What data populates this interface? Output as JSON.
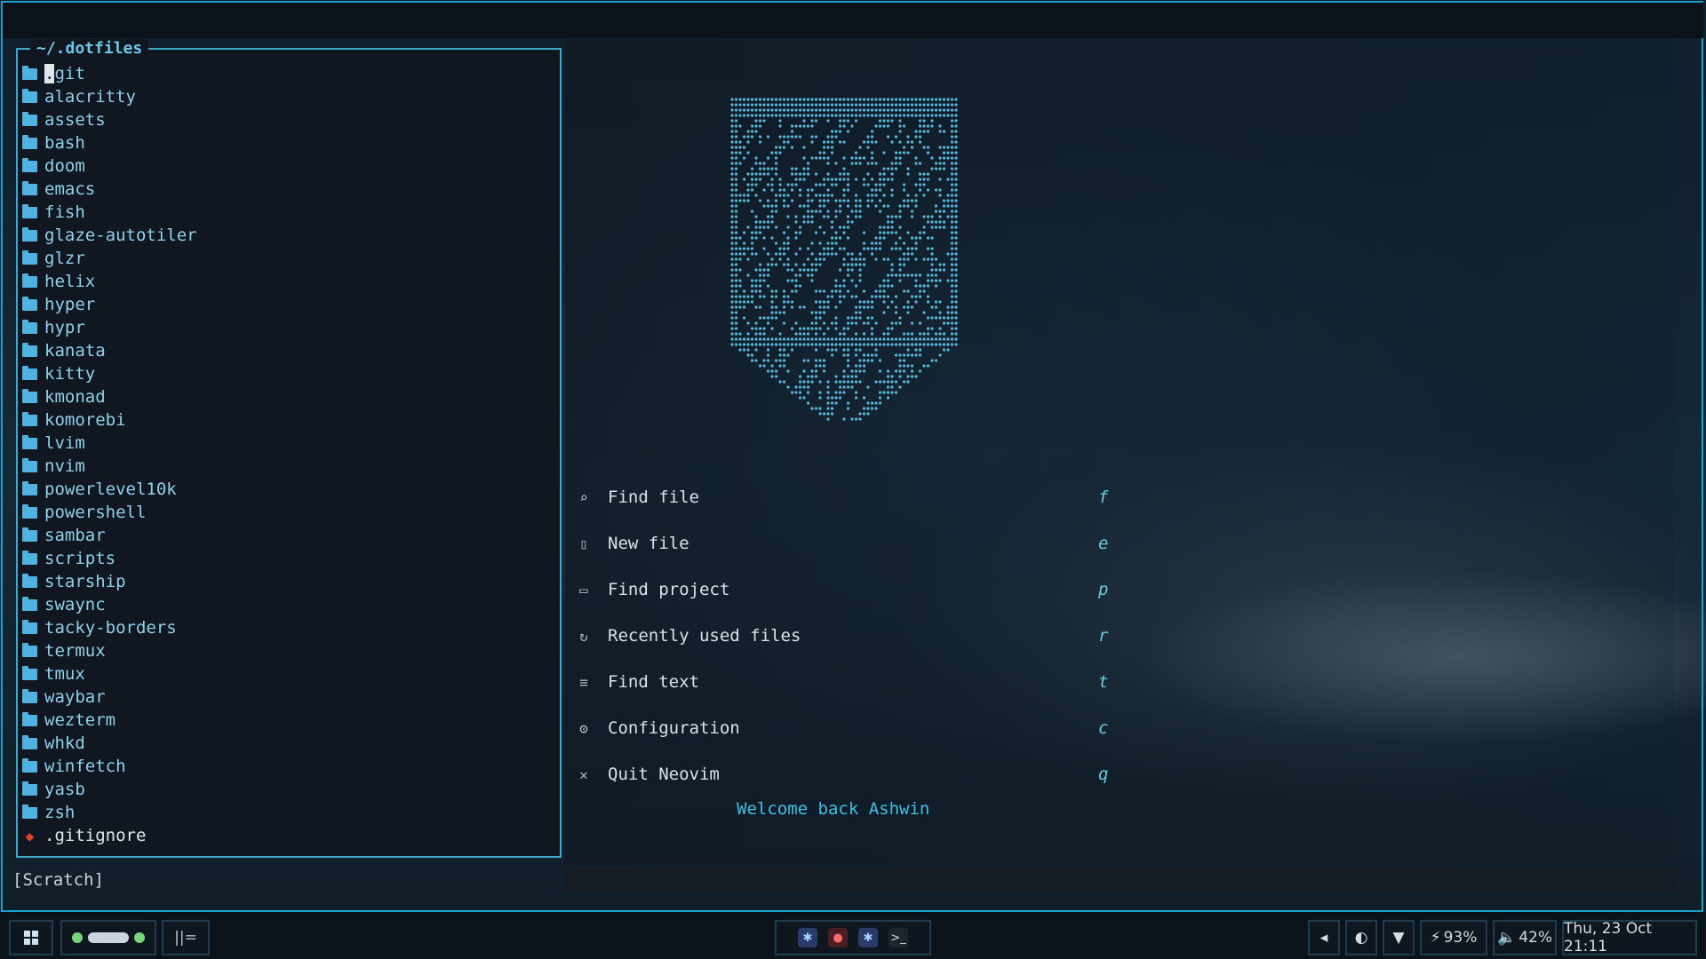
{
  "explorer": {
    "title": "~/.dotfiles",
    "items": [
      {
        "name": ".git",
        "type": "folder"
      },
      {
        "name": "alacritty",
        "type": "folder"
      },
      {
        "name": "assets",
        "type": "folder"
      },
      {
        "name": "bash",
        "type": "folder"
      },
      {
        "name": "doom",
        "type": "folder"
      },
      {
        "name": "emacs",
        "type": "folder"
      },
      {
        "name": "fish",
        "type": "folder"
      },
      {
        "name": "glaze-autotiler",
        "type": "folder"
      },
      {
        "name": "glzr",
        "type": "folder"
      },
      {
        "name": "helix",
        "type": "folder"
      },
      {
        "name": "hyper",
        "type": "folder"
      },
      {
        "name": "hypr",
        "type": "folder"
      },
      {
        "name": "kanata",
        "type": "folder"
      },
      {
        "name": "kitty",
        "type": "folder"
      },
      {
        "name": "kmonad",
        "type": "folder"
      },
      {
        "name": "komorebi",
        "type": "folder"
      },
      {
        "name": "lvim",
        "type": "folder"
      },
      {
        "name": "nvim",
        "type": "folder"
      },
      {
        "name": "powerlevel10k",
        "type": "folder"
      },
      {
        "name": "powershell",
        "type": "folder"
      },
      {
        "name": "sambar",
        "type": "folder"
      },
      {
        "name": "scripts",
        "type": "folder"
      },
      {
        "name": "starship",
        "type": "folder"
      },
      {
        "name": "swaync",
        "type": "folder"
      },
      {
        "name": "tacky-borders",
        "type": "folder"
      },
      {
        "name": "termux",
        "type": "folder"
      },
      {
        "name": "tmux",
        "type": "folder"
      },
      {
        "name": "waybar",
        "type": "folder"
      },
      {
        "name": "wezterm",
        "type": "folder"
      },
      {
        "name": "whkd",
        "type": "folder"
      },
      {
        "name": "winfetch",
        "type": "folder"
      },
      {
        "name": "yasb",
        "type": "folder"
      },
      {
        "name": "zsh",
        "type": "folder"
      },
      {
        "name": ".gitignore",
        "type": "git-file"
      }
    ]
  },
  "buffer": {
    "name": "[Scratch]"
  },
  "dashboard": {
    "menu": [
      {
        "icon": "search-icon",
        "label": "Find file",
        "key": "f"
      },
      {
        "icon": "file-icon",
        "label": "New file",
        "key": "e"
      },
      {
        "icon": "folder-open-icon",
        "label": "Find project",
        "key": "p"
      },
      {
        "icon": "history-icon",
        "label": "Recently used files",
        "key": "r"
      },
      {
        "icon": "text-lines-icon",
        "label": "Find text",
        "key": "t"
      },
      {
        "icon": "gear-icon",
        "label": "Configuration",
        "key": "c"
      },
      {
        "icon": "close-icon",
        "label": "Quit Neovim",
        "key": "q"
      }
    ],
    "welcome": "Welcome back Ashwin"
  },
  "taskbar": {
    "battery": "93%",
    "volume": "42%",
    "datetime": "Thu, 23 Oct 21:11"
  },
  "colors": {
    "accent": "#1a9fc8",
    "folder": "#4fb2e0",
    "git": "#e0462f",
    "welcome": "#3ec1e4"
  }
}
